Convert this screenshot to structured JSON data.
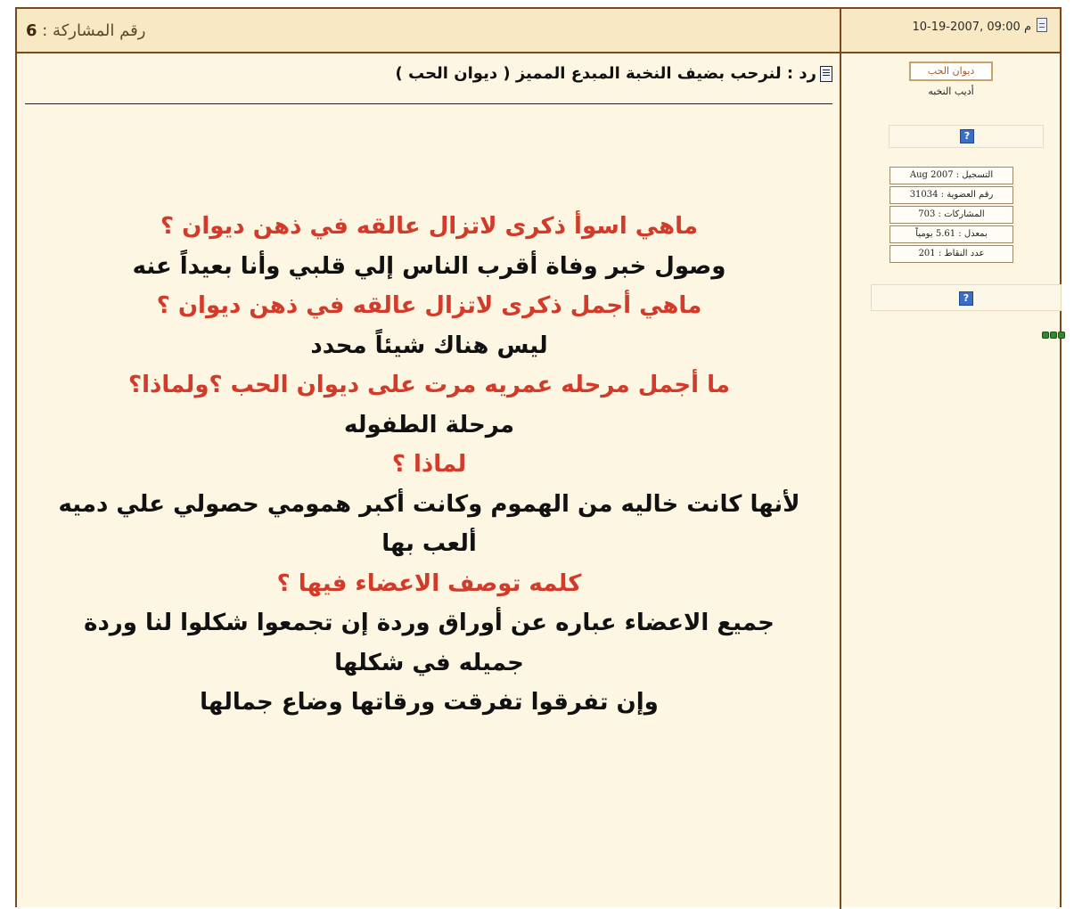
{
  "header": {
    "post_number_label": "رقم المشاركة :",
    "post_number": "6",
    "date": "10-19-2007, 09:00 م"
  },
  "user": {
    "name": "ديوان الحب",
    "title": "أديب النخبه",
    "stats": [
      "التسجيل : Aug 2007",
      "رقم العضوية : 31034",
      "المشاركات : 703",
      "بمعدل : 5.61 يومياً",
      "عدد النقاط : 201"
    ],
    "help_icon": "?"
  },
  "post": {
    "title": "رد : لنرحب بضيف النخبة المبدع المميز ( ديوان الحب )",
    "lines": [
      {
        "type": "q",
        "text": "ماهي اسوأ ذكرى لاتزال عالقه في ذهن ديوان ؟"
      },
      {
        "type": "a",
        "text": "وصول خبر وفاة أقرب الناس إلي قلبي وأنا بعيداً عنه"
      },
      {
        "type": "q",
        "text": "ماهي أجمل ذكرى لاتزال عالقه في ذهن ديوان ؟"
      },
      {
        "type": "a",
        "text": "ليس هناك شيئاً محدد"
      },
      {
        "type": "q",
        "text": "ما أجمل مرحله عمريه مرت على ديوان الحب ؟ولماذا؟"
      },
      {
        "type": "a",
        "text": "مرحلة الطفوله"
      },
      {
        "type": "q",
        "text": "لماذا ؟"
      },
      {
        "type": "a",
        "text": "لأنها كانت خاليه من الهموم وكانت أكبر همومي حصولي علي دميه ألعب بها"
      },
      {
        "type": "q",
        "text": "كلمه توصف الاعضاء فيها ؟"
      },
      {
        "type": "a",
        "text": "جميع الاعضاء عباره عن أوراق وردة إن تجمعوا شكلوا لنا وردة جميله في شكلها"
      },
      {
        "type": "a",
        "text": "وإن تفرقوا تفرقت ورقاتها وضاع جمالها"
      }
    ]
  },
  "colors": {
    "question": "#d23a2a",
    "answer": "#111111",
    "border": "#7a4a1e",
    "header_bg": "#f8e9c4",
    "body_bg": "#fdf6e3"
  }
}
